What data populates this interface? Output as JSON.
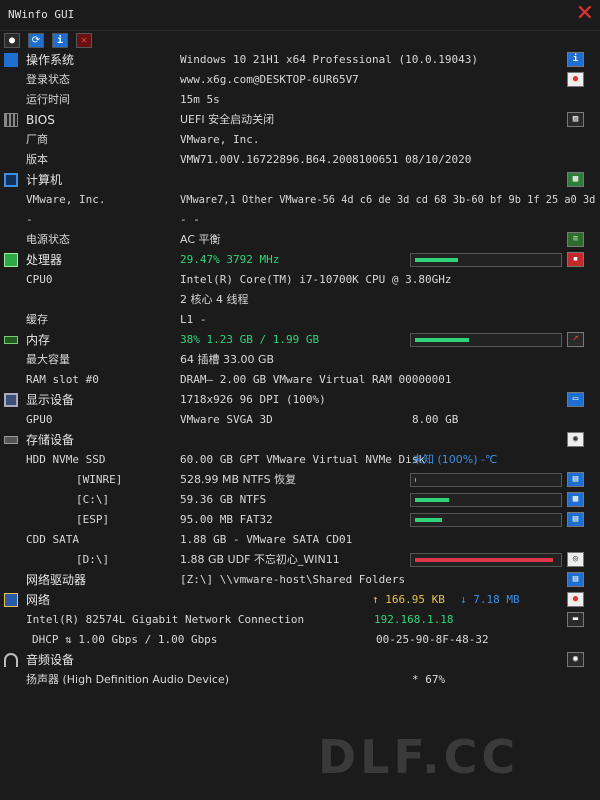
{
  "window": {
    "title": "NWinfo GUI"
  },
  "toolbar": {
    "icons": [
      "screenshot-icon",
      "refresh-icon",
      "info-icon",
      "close-icon"
    ]
  },
  "rows": [
    {
      "label": "操作系统",
      "value": "Windows 10 21H1 x64 Professional (10.0.19043)",
      "icon": "windows-icon"
    },
    {
      "label": "登录状态",
      "value": "www.x6g.com@DESKTOP-6UR65V7"
    },
    {
      "label": "运行时间",
      "value": "15m 5s"
    },
    {
      "label": "BIOS",
      "value": "UEFI 安全启动关闭",
      "icon": "chip-icon"
    },
    {
      "label": "厂商",
      "value": "VMware, Inc."
    },
    {
      "label": "版本",
      "value": "VMW71.00V.16722896.B64.2008100651 08/10/2020"
    },
    {
      "label": "计算机",
      "value": "",
      "icon": "computer-icon"
    },
    {
      "label": "VMware, Inc.",
      "value": "VMware7,1 Other VMware-56 4d c6 de 3d cd 68 3b-60 bf 9b 1f 25 a0 3d"
    },
    {
      "label": "-",
      "value": "- -"
    },
    {
      "label": "电源状态",
      "value": "AC  平衡"
    },
    {
      "label": "处理器",
      "value": "29.47% 3792 MHz",
      "icon": "cpu-icon",
      "bar": 0.3
    },
    {
      "label": "CPU0",
      "value": "Intel(R) Core(TM) i7-10700K CPU @ 3.80GHz"
    },
    {
      "label": "",
      "value": "2 核心 4 线程"
    },
    {
      "label": "缓存",
      "value": "L1 -"
    },
    {
      "label": "内存",
      "value": "38% 1.23 GB / 1.99 GB",
      "icon": "memory-icon",
      "bar": 0.38
    },
    {
      "label": "最大容量",
      "value": "64 插槽 33.00 GB"
    },
    {
      "label": "RAM slot #0",
      "value": "DRAM— 2.00 GB VMware Virtual RAM 00000001"
    },
    {
      "label": "显示设备",
      "value": "1718x926 96 DPI (100%)",
      "icon": "display-icon"
    },
    {
      "label": "GPU0",
      "value": "VMware SVGA 3D",
      "extra": "8.00 GB"
    },
    {
      "label": "存储设备",
      "value": "",
      "icon": "storage-icon"
    },
    {
      "label": "HDD NVMe SSD",
      "value": "60.00 GB GPT VMware Virtual NVMe Disk",
      "extra": "未知 (100%) -℃"
    },
    {
      "label": "[WINRE]",
      "value": "528.99 MB NTFS 恢复",
      "bar": 0.01
    },
    {
      "label": "[C:\\]",
      "value": "59.36 GB NTFS",
      "bar": 0.24
    },
    {
      "label": "[ESP]",
      "value": "95.00 MB FAT32",
      "bar": 0.19
    },
    {
      "label": "CDD SATA",
      "value": "1.88 GB - VMware SATA CD01"
    },
    {
      "label": "[D:\\]",
      "value": "1.88 GB UDF 不忘初心_WIN11",
      "bar": 0.97
    },
    {
      "label": "网络驱动器",
      "value": "[Z:\\] \\\\vmware-host\\Shared Folders"
    },
    {
      "label": "网络",
      "value": "",
      "icon": "network-icon",
      "up": "↑ 166.95 KB",
      "down": "↓ 7.18 MB"
    },
    {
      "label": "Intel(R) 82574L Gigabit Network Connection",
      "value": "",
      "extra": "192.168.1.18"
    },
    {
      "label": "DHCP ⇅ 1.00 Gbps / 1.00 Gbps",
      "value": "",
      "extra": "00-25-90-8F-48-32"
    },
    {
      "label": "音频设备",
      "value": "",
      "icon": "headphones-icon"
    },
    {
      "label": "扬声器 (High Definition Audio Device)",
      "value": "",
      "extra": "* 67%"
    }
  ],
  "watermark": "DLF.CC",
  "colors": {
    "green": "#2fd47a",
    "red": "#e0364a",
    "accent_blue": "#1e6fd0",
    "yellow": "#e8c04a"
  }
}
